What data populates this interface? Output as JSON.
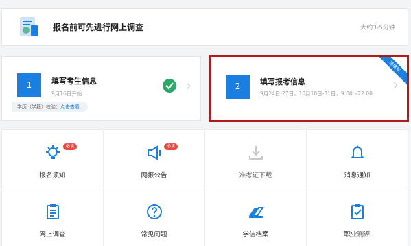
{
  "survey": {
    "title": "报名前可先进行网上调查",
    "duration": "大约3-5分钟"
  },
  "step1": {
    "number": "1",
    "title": "填写考生信息",
    "subtitle": "9月16日开始",
    "verify_label": "学历（学籍）校验：",
    "verify_link": "点击查看"
  },
  "step2": {
    "number": "2",
    "title": "填写报考信息",
    "subtitle": "9月24日-27日，10月10日-31日，9:00～22:00",
    "ribbon": "待填写"
  },
  "tiles": [
    {
      "label": "报名须知",
      "badge": "必读",
      "icon": "lightbulb-icon"
    },
    {
      "label": "网报公告",
      "badge": "必读",
      "icon": "megaphone-icon"
    },
    {
      "label": "准考证下载",
      "icon": "download-icon"
    },
    {
      "label": "消息通知",
      "icon": "bell-icon"
    },
    {
      "label": "网上调查",
      "icon": "clipboard-icon"
    },
    {
      "label": "常见问题",
      "icon": "question-icon"
    },
    {
      "label": "学信档案",
      "icon": "archive-icon"
    },
    {
      "label": "职业测评",
      "icon": "checklist-icon"
    }
  ],
  "colors": {
    "accent": "#1a7fe0",
    "success": "#2aa868",
    "badge": "#e8493f",
    "highlight_border": "#b01a1a"
  }
}
